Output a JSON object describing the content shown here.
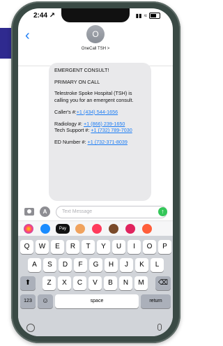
{
  "status": {
    "time": "2:44 ↗"
  },
  "header": {
    "back_label": "‹",
    "avatar_initial": "O",
    "contact_name": "OneCall TSH >"
  },
  "message": {
    "line1": "EMERGENT CONSULT!",
    "line2": "PRIMARY ON CALL",
    "line3": "Telestroke Spoke Hospital (TSH) is calling you for an emergent consult.",
    "caller_label": "Caller's #:",
    "caller_number": "+1 (434) 544-1656",
    "radiology_label": "Radiology #:",
    "radiology_number": "+1 (866) 239-1650",
    "tech_label": "Tech Support #:",
    "tech_number": "+1 (732) 789-7030",
    "ed_label": "ED Number #:",
    "ed_number": "+1 (732-371-8039"
  },
  "compose": {
    "placeholder": "Text Message",
    "send_icon": "↑",
    "apps_icon": "A"
  },
  "app_row": {
    "icons": [
      "photos-icon",
      "app-store-icon",
      "apple-pay-icon",
      "memoji-icon",
      "search-images-icon",
      "music-icon",
      "heart-icon",
      "more-app-icon"
    ],
    "apple_pay_label": "Pay"
  },
  "keyboard": {
    "row1": [
      "Q",
      "W",
      "E",
      "R",
      "T",
      "Y",
      "U",
      "I",
      "O",
      "P"
    ],
    "row2": [
      "A",
      "S",
      "D",
      "F",
      "G",
      "H",
      "J",
      "K",
      "L"
    ],
    "row3": [
      "Z",
      "X",
      "C",
      "V",
      "B",
      "N",
      "M"
    ],
    "shift": "⬆",
    "backspace": "⌫",
    "numbers": "123",
    "emoji": "☺",
    "space": "space",
    "return": "return"
  },
  "colors": {
    "link": "#1a7cf5",
    "bubble": "#e9e9eb",
    "send": "#34c759"
  }
}
